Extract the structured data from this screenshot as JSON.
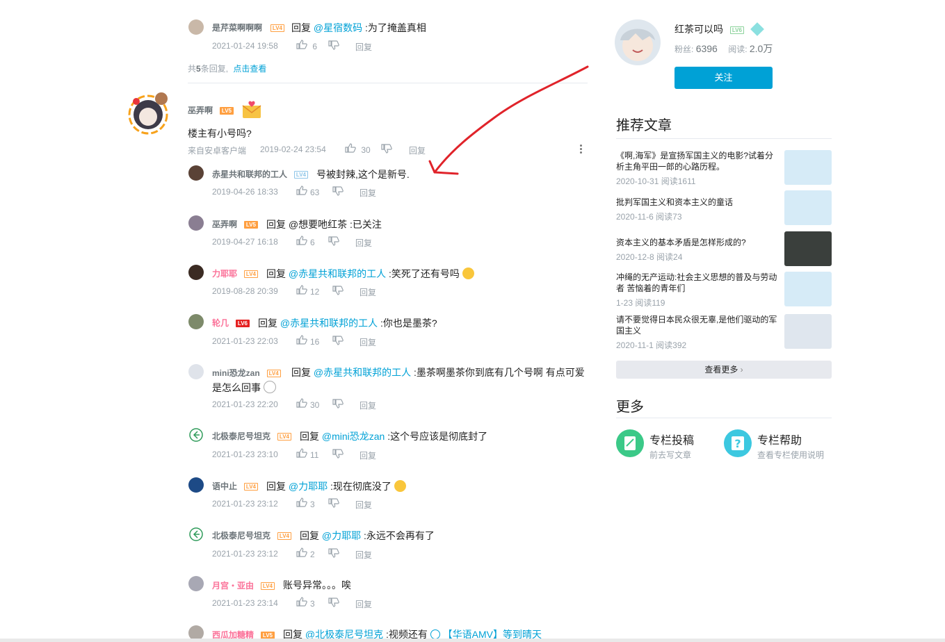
{
  "top_reply": {
    "user": "是芹菜啊啊啊",
    "level": "LV4",
    "reply_word": "回复",
    "mention": "@星宿数码",
    "text": ":为了掩盖真相",
    "time": "2021-01-24 19:58",
    "likes": "6",
    "reply_label": "回复"
  },
  "more_replies": {
    "prefix": "共",
    "count": "5",
    "suffix": "条回复,",
    "link": "点击查看"
  },
  "main_comment": {
    "user": "巫弄啊",
    "level": "LV5",
    "text": "楼主有小号吗?",
    "source": "来自安卓客户端",
    "time": "2019-02-24 23:54",
    "likes": "30",
    "reply_label": "回复"
  },
  "replies": [
    {
      "user": "赤星共和联邦的工人",
      "level": "LV4",
      "reply_word": "",
      "mention": "",
      "text": "号被封辣,这个是新号.",
      "time": "2019-04-26 18:33",
      "likes": "63",
      "reply_label": "回复"
    },
    {
      "user": "巫弄啊",
      "level": "LV5",
      "reply_word": "回复",
      "mention": "@想要吔红茶",
      "text": ":已关注",
      "time": "2019-04-27 16:18",
      "likes": "6",
      "reply_label": "回复"
    },
    {
      "user": "力耶耶",
      "level": "LV4",
      "reply_word": "回复",
      "mention": "@赤星共和联邦的工人",
      "text": ":笑死了还有号吗",
      "time": "2019-08-28 20:39",
      "likes": "12",
      "reply_label": "回复"
    },
    {
      "user": "轮几",
      "level": "LV6",
      "reply_word": "回复",
      "mention": "@赤星共和联邦的工人",
      "text": ":你也是墨茶?",
      "time": "2021-01-23 22:03",
      "likes": "16",
      "reply_label": "回复"
    },
    {
      "user": "mini恐龙zan",
      "level": "LV4",
      "reply_word": "回复",
      "mention": "@赤星共和联邦的工人",
      "text": ":墨茶啊墨茶你到底有几个号啊 有点可爱",
      "text2": "是怎么回事",
      "time": "2021-01-23 22:20",
      "likes": "30",
      "reply_label": "回复"
    },
    {
      "user": "北极泰尼号坦克",
      "level": "LV4",
      "reply_word": "回复",
      "mention": "@mini恐龙zan",
      "text": ":这个号应该是彻底封了",
      "time": "2021-01-23 23:10",
      "likes": "11",
      "reply_label": "回复"
    },
    {
      "user": "语中止",
      "level": "LV4",
      "reply_word": "回复",
      "mention": "@力耶耶",
      "text": ":现在彻底没了",
      "time": "2021-01-23 23:12",
      "likes": "3",
      "reply_label": "回复"
    },
    {
      "user": "北极泰尼号坦克",
      "level": "LV4",
      "reply_word": "回复",
      "mention": "@力耶耶",
      "text": ":永远不会再有了",
      "time": "2021-01-23 23:12",
      "likes": "2",
      "reply_label": "回复"
    },
    {
      "user": "月宫・亚由",
      "level": "LV4",
      "reply_word": "",
      "mention": "",
      "text": "账号异常。。。唉",
      "time": "2021-01-23 23:14",
      "likes": "3",
      "reply_label": "回复"
    },
    {
      "user": "西瓜加糖精",
      "level": "LV5",
      "reply_word": "回复",
      "mention": "@北极泰尼号坦克",
      "text": ":视频还有",
      "video": "【华语AMV】等到晴天"
    }
  ],
  "author": {
    "name": "红茶可以吗",
    "level": "LV6",
    "fans_label": "粉丝:",
    "fans": "6396",
    "reads_label": "阅读:",
    "reads": "2.0万",
    "follow": "关注"
  },
  "recommended": {
    "title": "推荐文章",
    "items": [
      {
        "title": "《啊,海军》是宣扬军国主义的电影?试着分析主角平田一郎的心路历程。",
        "meta": "2020-10-31 阅读1611"
      },
      {
        "title": "批判军国主义和资本主义的童话",
        "meta": "2020-11-6 阅读73"
      },
      {
        "title": "资本主义的基本矛盾是怎样形成的?",
        "meta": "2020-12-8 阅读24"
      },
      {
        "title": "冲绳的无产运动:社会主义思想的普及与劳动者 苦恼着的青年们",
        "meta": "1-23 阅读119"
      },
      {
        "title": "请不要觉得日本民众很无辜,是他们驱动的军国主义",
        "meta": "2020-11-1 阅读392"
      }
    ],
    "more": "查看更多"
  },
  "more_section": {
    "title": "更多",
    "submit_title": "专栏投稿",
    "submit_sub": "前去写文章",
    "help_title": "专栏帮助",
    "help_sub": "查看专栏使用说明"
  },
  "colors": {
    "accent": "#00a1d6",
    "pink": "#fb7299",
    "annotation": "#e0232a"
  }
}
